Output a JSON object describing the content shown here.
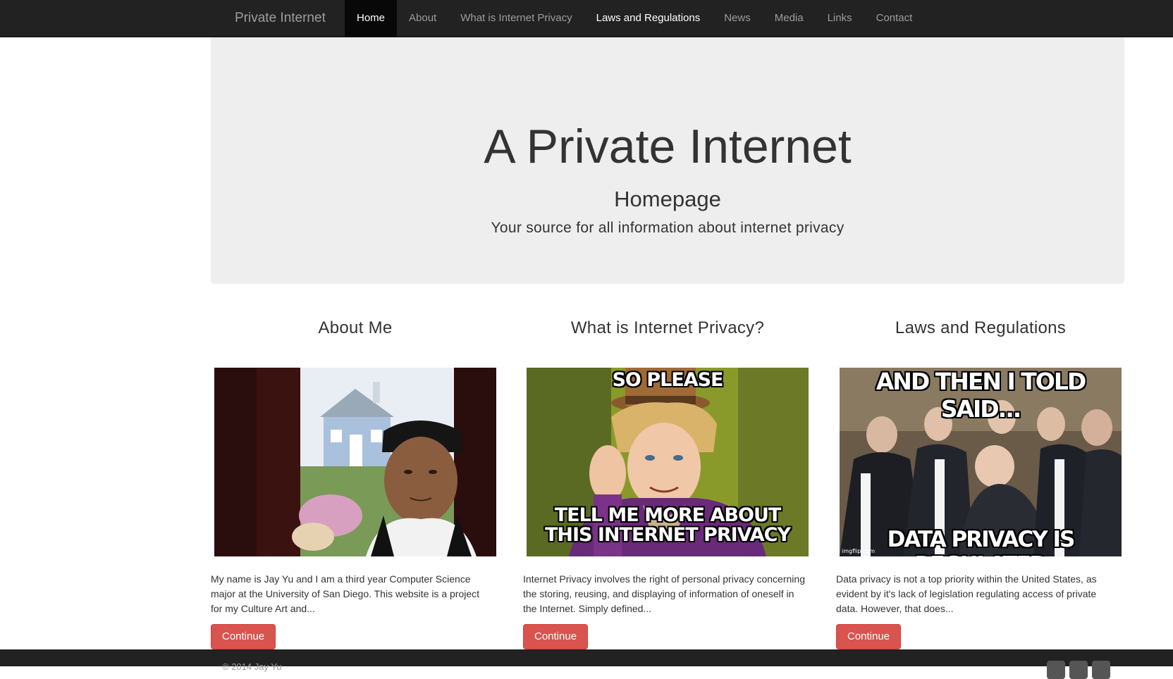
{
  "navbar": {
    "brand": "Private Internet",
    "items": [
      {
        "label": "Home"
      },
      {
        "label": "About"
      },
      {
        "label": "What is Internet Privacy"
      },
      {
        "label": "Laws and Regulations"
      },
      {
        "label": "News"
      },
      {
        "label": "Media"
      },
      {
        "label": "Links"
      },
      {
        "label": "Contact"
      }
    ]
  },
  "hero": {
    "title": "A Private Internet",
    "subtitle": "Homepage",
    "lead": "Your source for all information about internet privacy"
  },
  "columns": [
    {
      "title": "About Me",
      "text": "My name is Jay Yu and I am a third year Computer Science major at the University of San Diego. This website is a project for my Culture Art and...",
      "button": "Continue"
    },
    {
      "title": "What is Internet Privacy?",
      "text": "Internet Privacy involves the right of personal privacy concerning the storing, reusing, and displaying of information of oneself in the Internet. Simply defined...",
      "button": "Continue",
      "meme_top": "SO PLEASE",
      "meme_bottom_1": "TELL ME MORE ABOUT",
      "meme_bottom_2": "THIS INTERNET PRIVACY"
    },
    {
      "title": "Laws and Regulations",
      "text": "Data privacy is not a top priority within the United States, as evident by it's lack of legislation regulating access of private data. However, that does...",
      "button": "Continue",
      "meme_top": "AND THEN I TOLD SAID...",
      "meme_bottom": "DATA PRIVACY IS REGULATED",
      "watermark": "imgflip.com"
    }
  ],
  "footer": {
    "copyright": "© 2014 Jay Yu"
  },
  "colors": {
    "navbar_bg": "#222222",
    "nav_active_bg": "#080808",
    "jumbotron_bg": "#eeeeee",
    "button_danger": "#d9534f"
  }
}
